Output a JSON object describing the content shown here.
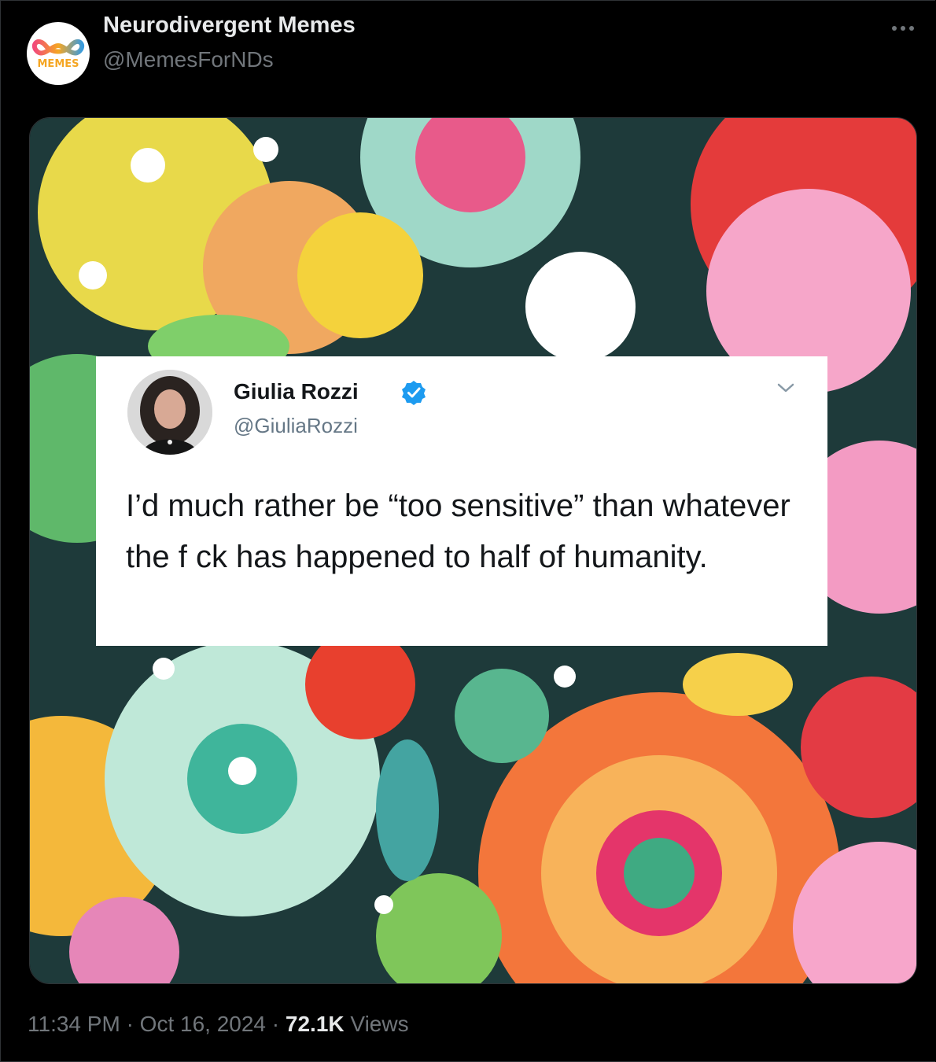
{
  "author": {
    "name": "Neurodivergent Memes",
    "handle": "@MemesForNDs",
    "avatar_label": "MEMES"
  },
  "post": {
    "time": "11:34 PM",
    "separator": "·",
    "date": "Oct 16, 2024",
    "views_count": "72.1K",
    "views_label": "Views"
  },
  "embedded_tweet": {
    "name": "Giulia Rozzi",
    "handle": "@GiuliaRozzi",
    "verified": true,
    "text": "I’d much rather be “too sensitive” than whatever the f  ck has happened to half of humanity."
  },
  "colors": {
    "background": "#000000",
    "primary_text": "#e7e9ea",
    "secondary_text": "#71767b",
    "verified_badge": "#1d9bf0"
  },
  "icons": [
    "more-icon",
    "verified-badge-icon",
    "chevron-down-icon",
    "infinity-logo-icon"
  ]
}
